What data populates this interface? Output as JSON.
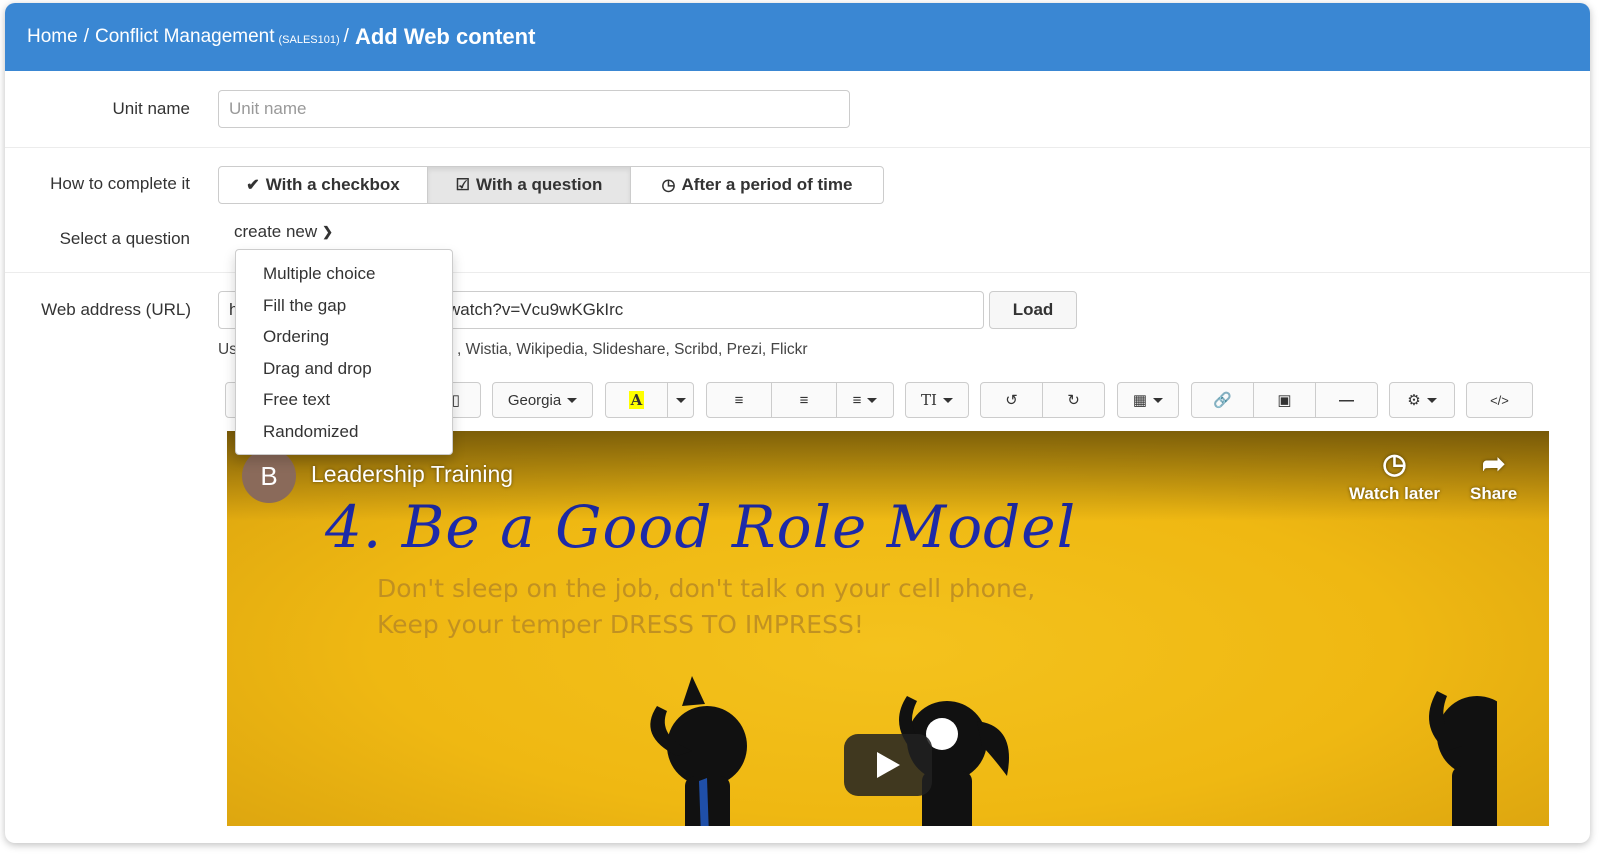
{
  "breadcrumb": {
    "home": "Home",
    "sep1": "/",
    "course": "Conflict Management",
    "course_code": "(SALES101)",
    "sep2": "/",
    "current": "Add Web content"
  },
  "unit_name": {
    "label": "Unit name",
    "placeholder": "Unit name"
  },
  "complete": {
    "label": "How to complete it",
    "options": [
      {
        "icon": "check-icon",
        "label": "With a checkbox"
      },
      {
        "icon": "checkbox-icon",
        "label": "With a question",
        "active": true
      },
      {
        "icon": "clock-icon",
        "label": "After a period of time"
      }
    ]
  },
  "question": {
    "label": "Select a question",
    "selected": "create new",
    "menu": [
      "Multiple choice",
      "Fill the gap",
      "Ordering",
      "Drag and drop",
      "Free text",
      "Randomized"
    ]
  },
  "url": {
    "label": "Web address (URL)",
    "value_start": "h",
    "value_end": "watch?v=Vcu9wKGkIrc",
    "load_label": "Load",
    "help_start": "Us",
    "help_end": ", Wistia, Wikipedia, Slideshare, Scribd, Prezi, Flickr"
  },
  "toolbar": {
    "font": "Georgia",
    "color_letter": "A",
    "text_size": "TI",
    "icons": [
      "font-color-icon",
      "bullet-list-icon",
      "numbered-list-icon",
      "align-icon",
      "undo-icon",
      "redo-icon",
      "table-icon",
      "link-icon",
      "image-icon",
      "horizontal-rule-icon",
      "settings-icon",
      "code-view-icon"
    ]
  },
  "video": {
    "channel_initial": "B",
    "title": "Leadership Training",
    "watch_later": "Watch later",
    "share": "Share",
    "slide_title": "4. Be a Good Role Model",
    "slide_text": "Don't sleep on the job, don't talk on your cell phone, Keep your temper DRESS TO IMPRESS!"
  },
  "colors": {
    "header": "#3a87d3",
    "slide_bg": "#efb812",
    "slide_title": "#1d2aa8"
  }
}
